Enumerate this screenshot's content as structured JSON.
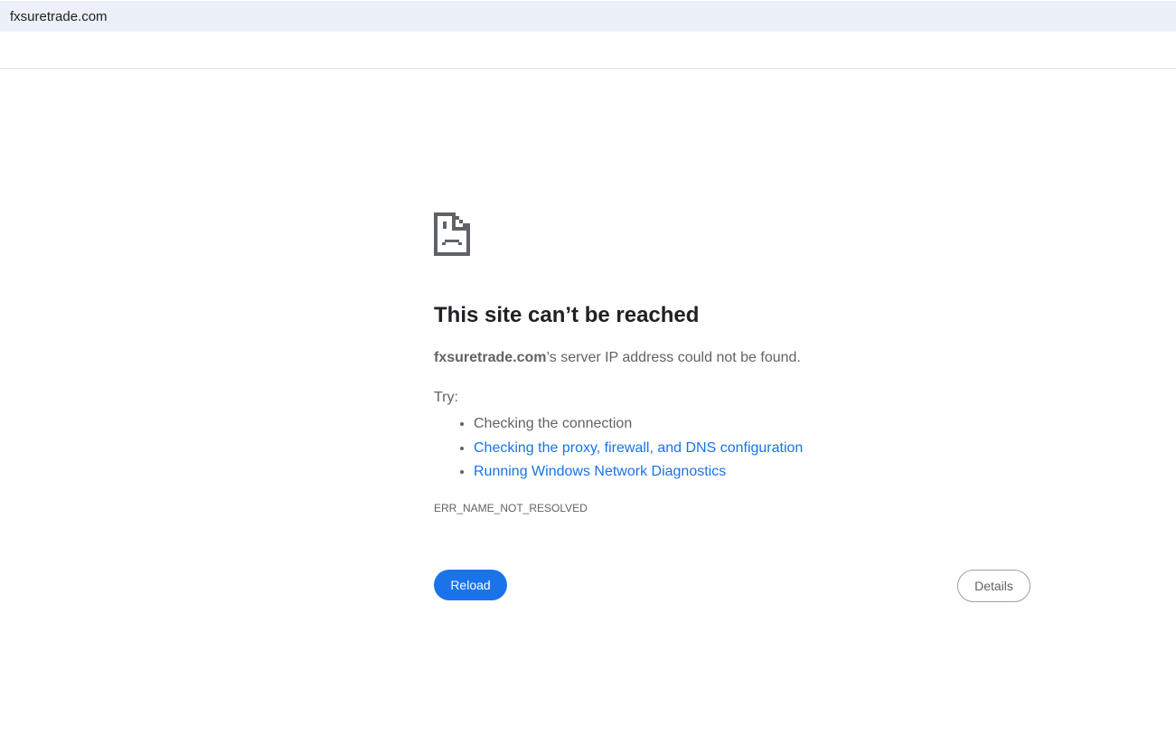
{
  "address_bar": {
    "url": "fxsuretrade.com"
  },
  "error": {
    "icon": "sad-page-icon",
    "title": "This site can’t be reached",
    "host": "fxsuretrade.com",
    "message_suffix": "’s server IP address could not be found.",
    "try_label": "Try:",
    "suggestions": [
      "Checking the connection",
      "Checking the proxy, firewall, and DNS configuration",
      "Running Windows Network Diagnostics"
    ],
    "code": "ERR_NAME_NOT_RESOLVED"
  },
  "buttons": {
    "reload": "Reload",
    "details": "Details"
  },
  "colors": {
    "accent": "#1a73e8",
    "text": "#5f6368",
    "address_bg": "#ecf0f8"
  }
}
